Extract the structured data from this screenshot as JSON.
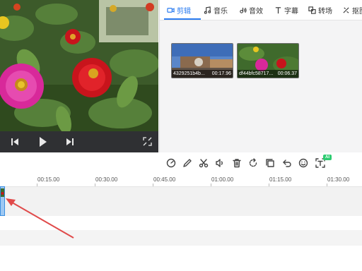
{
  "tabs": [
    {
      "label": "剪辑",
      "icon": "video-clip-icon",
      "active": true
    },
    {
      "label": "音乐",
      "icon": "music-icon",
      "active": false
    },
    {
      "label": "音效",
      "icon": "sound-effect-icon",
      "active": false
    },
    {
      "label": "字幕",
      "icon": "text-icon",
      "active": false
    },
    {
      "label": "转场",
      "icon": "transition-icon",
      "active": false
    },
    {
      "label": "抠图",
      "icon": "cutout-icon",
      "active": false
    }
  ],
  "media": [
    {
      "name": "4329251b4b...",
      "duration": "00:17.96"
    },
    {
      "name": "df44bfc58717...",
      "duration": "00:06.37"
    }
  ],
  "player": {
    "controls": [
      "prev-frame-icon",
      "play-icon",
      "next-frame-icon",
      "fullscreen-icon"
    ]
  },
  "toolbar": {
    "tools": [
      "speed-icon",
      "pen-icon",
      "scissors-icon",
      "volume-icon",
      "delete-icon",
      "rotate-icon",
      "copy-icon",
      "undo-icon",
      "emoji-icon",
      "ai-text-icon"
    ],
    "ai_badge": "AI"
  },
  "timeline": {
    "ticks": [
      "00:15.00",
      "00:30.00",
      "00:45.00",
      "01:00.00",
      "01:15.00",
      "01:30.00"
    ]
  },
  "colors": {
    "accent": "#2b7cf0",
    "annotation_arrow": "#e04a4a",
    "clip_fill": "#9ec8f2"
  }
}
